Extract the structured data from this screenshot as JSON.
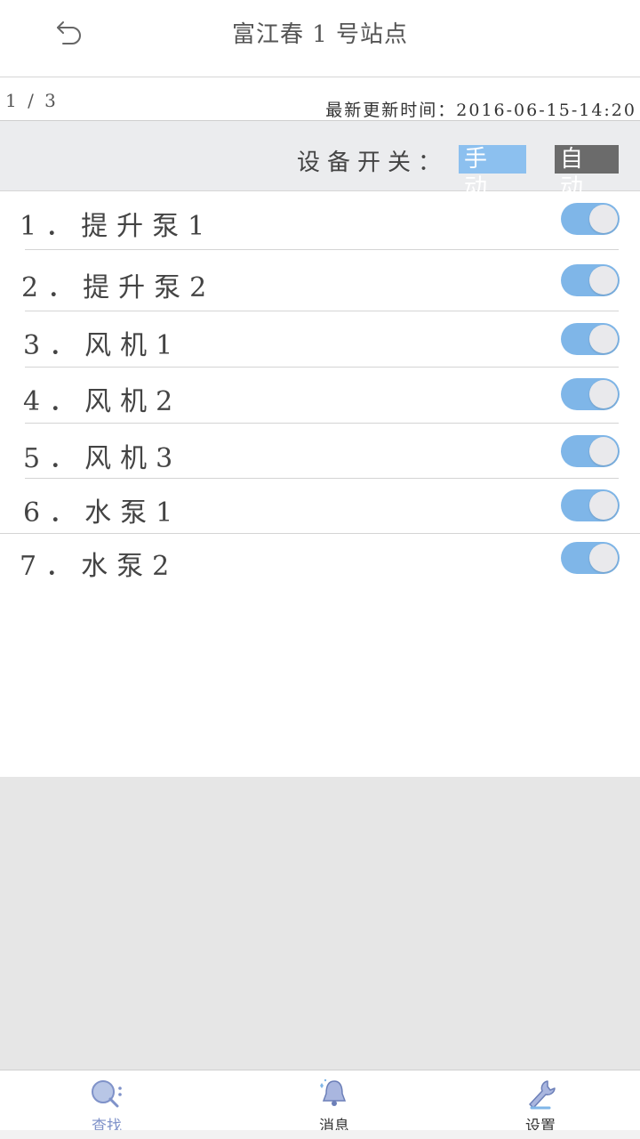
{
  "header": {
    "title": "富江春 1 号站点",
    "back_icon": "undo-arrow-icon"
  },
  "infobar": {
    "page_indicator": "1 / 3",
    "update_time": "最新更新时间：2016-06-15-14:20"
  },
  "modebar": {
    "label": "设备开关：",
    "manual_label": "手动",
    "auto_label": "自动",
    "selected": "manual",
    "manual_color": "#8cc0ef",
    "auto_color": "#6b6b6b"
  },
  "devices": [
    {
      "label": "1．提升泵1",
      "on": true
    },
    {
      "label": "2．提升泵2",
      "on": true
    },
    {
      "label": "3．风机1",
      "on": true
    },
    {
      "label": "4．风机2",
      "on": true
    },
    {
      "label": "5．风机3",
      "on": true
    },
    {
      "label": "6．水泵1",
      "on": true
    },
    {
      "label": "7．水泵2",
      "on": true
    }
  ],
  "colors": {
    "toggle_on": "#7fb6e8",
    "nav_active": "#7f92c9"
  },
  "bottom_nav": [
    {
      "label": "查找",
      "icon": "search-icon",
      "active": true
    },
    {
      "label": "消息",
      "icon": "bell-icon",
      "active": false
    },
    {
      "label": "设置",
      "icon": "wrench-icon",
      "active": false
    }
  ]
}
